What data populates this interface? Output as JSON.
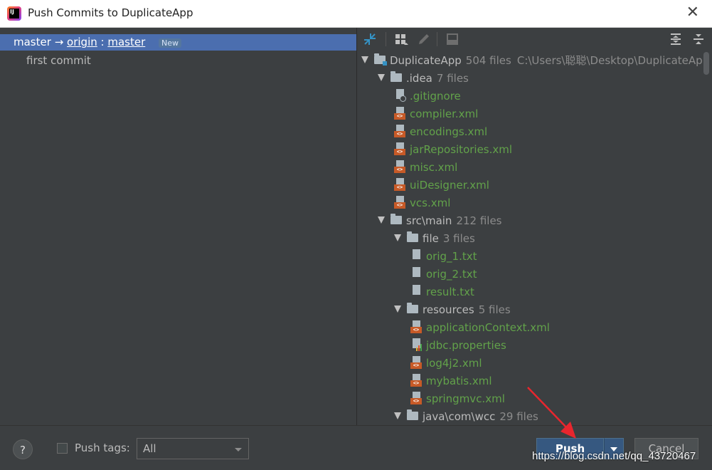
{
  "window": {
    "title": "Push Commits to DuplicateApp"
  },
  "left": {
    "branch": {
      "local": "master",
      "arrow": "→",
      "remote": "origin",
      "colon": " : ",
      "remote_branch": "master",
      "badge": "New"
    },
    "commits": [
      "first commit"
    ]
  },
  "toolbar": {
    "icons": [
      "show-diff-icon",
      "group-by-icon",
      "edit-icon",
      "preview-icon",
      "expand-all-icon",
      "collapse-all-icon"
    ]
  },
  "tree": [
    {
      "type": "folder",
      "depth": 0,
      "expanded": true,
      "name": "DuplicateApp",
      "count": "504 files",
      "path": "C:\\Users\\聪聪\\Desktop\\DuplicateAp",
      "root": true
    },
    {
      "type": "folder",
      "depth": 1,
      "expanded": true,
      "name": ".idea",
      "count": "7 files"
    },
    {
      "type": "file",
      "depth": 2,
      "icon": "ignore",
      "name": ".gitignore"
    },
    {
      "type": "file",
      "depth": 2,
      "icon": "xml",
      "name": "compiler.xml"
    },
    {
      "type": "file",
      "depth": 2,
      "icon": "xml",
      "name": "encodings.xml"
    },
    {
      "type": "file",
      "depth": 2,
      "icon": "xml",
      "name": "jarRepositories.xml"
    },
    {
      "type": "file",
      "depth": 2,
      "icon": "xml",
      "name": "misc.xml"
    },
    {
      "type": "file",
      "depth": 2,
      "icon": "xml",
      "name": "uiDesigner.xml"
    },
    {
      "type": "file",
      "depth": 2,
      "icon": "xml",
      "name": "vcs.xml"
    },
    {
      "type": "folder",
      "depth": 1,
      "expanded": true,
      "name": "src\\main",
      "count": "212 files"
    },
    {
      "type": "folder",
      "depth": 2,
      "expanded": true,
      "name": "file",
      "count": "3 files"
    },
    {
      "type": "file",
      "depth": 3,
      "icon": "text",
      "name": "orig_1.txt"
    },
    {
      "type": "file",
      "depth": 3,
      "icon": "text",
      "name": "orig_2.txt"
    },
    {
      "type": "file",
      "depth": 3,
      "icon": "text",
      "name": "result.txt"
    },
    {
      "type": "folder",
      "depth": 2,
      "expanded": true,
      "name": "resources",
      "count": "5 files"
    },
    {
      "type": "file",
      "depth": 3,
      "icon": "xml",
      "name": "applicationContext.xml"
    },
    {
      "type": "file",
      "depth": 3,
      "icon": "properties",
      "name": "jdbc.properties"
    },
    {
      "type": "file",
      "depth": 3,
      "icon": "xml",
      "name": "log4j2.xml"
    },
    {
      "type": "file",
      "depth": 3,
      "icon": "xml",
      "name": "mybatis.xml"
    },
    {
      "type": "file",
      "depth": 3,
      "icon": "xml",
      "name": "springmvc.xml"
    },
    {
      "type": "folder",
      "depth": 2,
      "expanded": true,
      "name": "java\\com\\wcc",
      "count": "29 files"
    }
  ],
  "footer": {
    "help": "?",
    "push_tags_label": "Push tags:",
    "push_tags_value": "All",
    "push_label": "Push",
    "cancel_label": "Cancel"
  },
  "watermark": "https://blog.csdn.net/qq_43720467",
  "colors": {
    "selection": "#4b6eaf",
    "added_file": "#62a24a",
    "push_button": "#365880",
    "annotation_arrow": "#e8262e"
  }
}
